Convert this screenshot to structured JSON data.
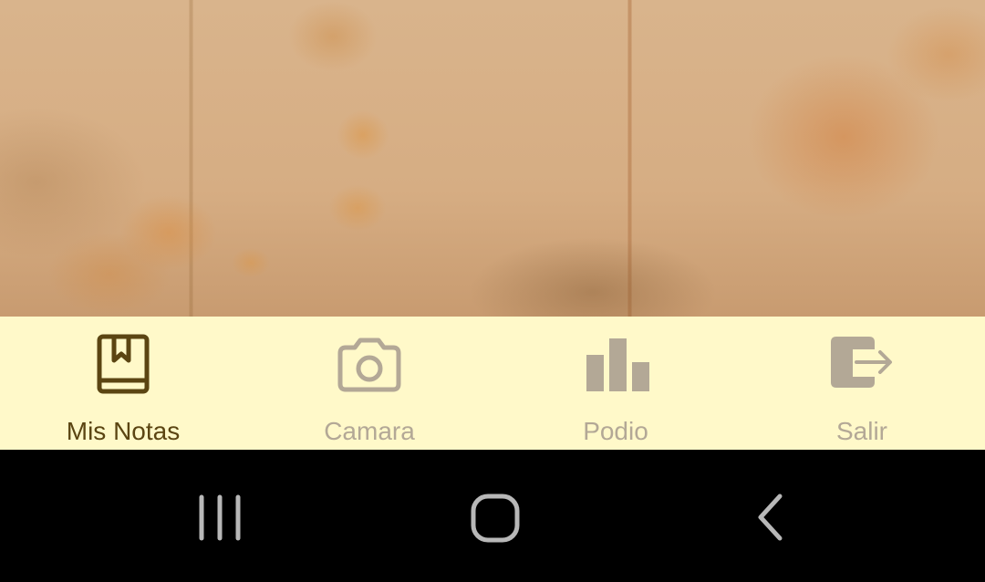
{
  "bottom_nav": {
    "active_color": "#5b4512",
    "inactive_color": "#b3a896",
    "background": "#fff9c9",
    "items": [
      {
        "label": "Mis Notas",
        "icon": "book-icon",
        "active": true
      },
      {
        "label": "Camara",
        "icon": "camera-icon",
        "active": false
      },
      {
        "label": "Podio",
        "icon": "bar-chart-icon",
        "active": false
      },
      {
        "label": "Salir",
        "icon": "logout-icon",
        "active": false
      }
    ]
  },
  "system_nav": {
    "buttons": [
      {
        "name": "recent-apps",
        "icon": "recent-apps-icon"
      },
      {
        "name": "home",
        "icon": "home-icon"
      },
      {
        "name": "back",
        "icon": "back-icon"
      }
    ]
  }
}
